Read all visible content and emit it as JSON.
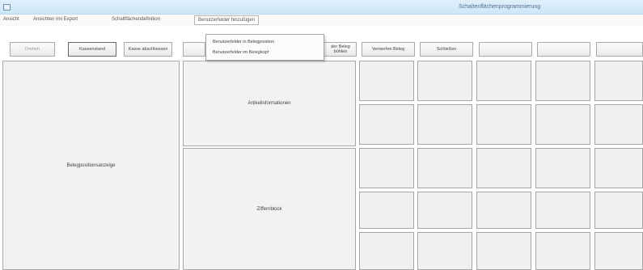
{
  "window": {
    "title": "Schaltenflächenprogrammierung"
  },
  "menu": {
    "items": [
      "Ansicht",
      "Ansichten Imi Export",
      "Schaltflächendefinition",
      "Benutzerfelder hinzufügen"
    ],
    "dropdown_items": [
      "Benutzerfelder in Belegposition",
      "Benutzerfelder im Belegkopf"
    ]
  },
  "toolbar": {
    "buttons": [
      "Drehen",
      "Kassenstand",
      "Kasse abschliessen",
      "der Beleg bühlen",
      "Verwerfen Beleg",
      "Schließen"
    ]
  },
  "panels": {
    "belegpositionsanzeige": "Belegpositionsanzeige",
    "artikelinformationen": "Artikelinformationen",
    "ziffernblock": "Ziffernblock"
  }
}
